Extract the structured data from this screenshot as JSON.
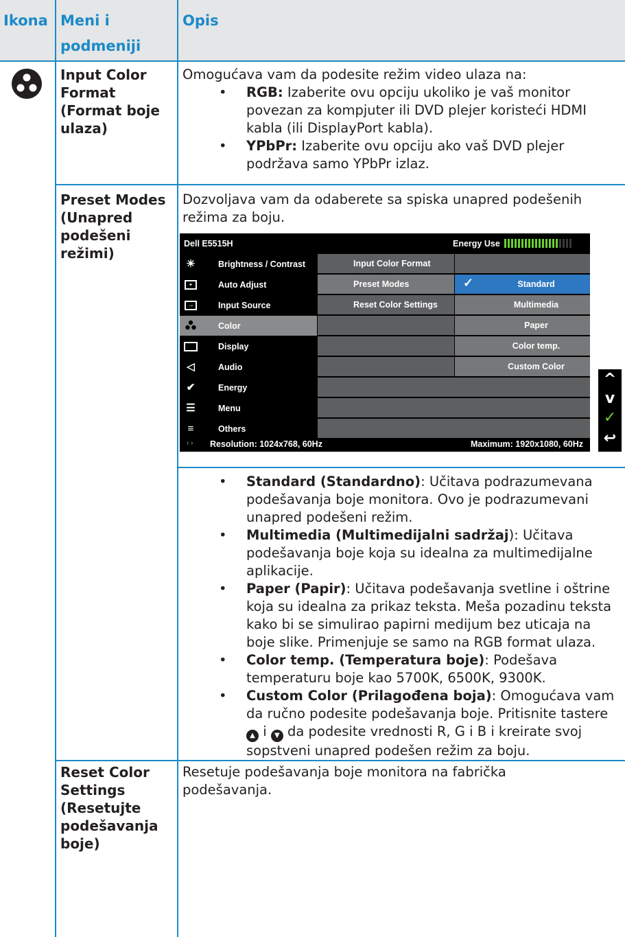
{
  "header": {
    "col_icon": "Ikona",
    "col_menu_line1": "Meni i",
    "col_menu_line2": "podmeniji",
    "col_desc": "Opis"
  },
  "row1": {
    "icon": "color-icon",
    "title_lines": [
      "Input Color",
      "Format",
      "(Format boje",
      "ulaza)"
    ],
    "intro": "Omogućava vam da podesite režim video ulaza na:",
    "items": [
      {
        "term": "RGB:",
        "text": " Izaberite ovu opciju ukoliko je vaš monitor povezan za kompjuter ili DVD plejer koristeći HDMI kabla (ili DisplayPort kabla)."
      },
      {
        "term": "YPbPr:",
        "text": " Izaberite ovu opciju ako vaš DVD plejer podržava samo YPbPr izlaz."
      }
    ]
  },
  "row2": {
    "title_lines": [
      "Preset Modes",
      "(Unapred",
      "podešeni",
      "režimi)"
    ],
    "intro": "Dozvoljava vam da odaberete sa spiska unapred podešenih režima za boju.",
    "items": [
      {
        "term": "Standard (Standardno)",
        "text": ": Učitava podrazumevana podešavanja boje monitora. Ovo je podrazumevani unapred podešeni režim."
      },
      {
        "term": "Multimedia (Multimedijalni sadržaj",
        "text": "): Učitava podešavanja boje koja su idealna za multimedijalne aplikacije."
      },
      {
        "term": "Paper (Papir)",
        "text": ": Učitava podešavanja svetline i oštrine koja su idealna za prikaz teksta. Meša pozadinu teksta kako bi se simulirao papirni medijum bez uticaja na boje slike. Primenjuje se samo na RGB format ulaza."
      },
      {
        "term": "Color temp. (Temperatura boje)",
        "text": ": Podešava temperaturu boje kao 5700K, 6500K, 9300K."
      },
      {
        "term": "Custom Color (Prilagođena boja)",
        "text": ": Omogućava vam da ručno podesite podešavanja boje. Pritisnite tastere",
        "mid": " i ",
        "text2": " da podesite vrednosti R, G i B i kreirate svoj sopstveni unapred podešen režim za boju."
      }
    ]
  },
  "row3": {
    "title_lines": [
      "Reset Color",
      "Settings",
      "(Resetujte",
      "podešavanja",
      "boje)"
    ],
    "desc": "Resetuje podešavanja boje monitora na fabrička podešavanja."
  },
  "osd": {
    "model": "Dell E5515H",
    "energy_label": "Energy Use",
    "energy_level": 0.8,
    "menu": [
      {
        "label": "Brightness / Contrast",
        "icon": "brightness-icon"
      },
      {
        "label": "Auto Adjust",
        "icon": "auto-adjust-icon"
      },
      {
        "label": "Input Source",
        "icon": "input-source-icon"
      },
      {
        "label": "Color",
        "icon": "color-icon",
        "selected": true
      },
      {
        "label": "Display",
        "icon": "display-icon"
      },
      {
        "label": "Audio",
        "icon": "audio-icon"
      },
      {
        "label": "Energy",
        "icon": "energy-icon"
      },
      {
        "label": "Menu",
        "icon": "menu-icon"
      },
      {
        "label": "Others",
        "icon": "others-icon"
      }
    ],
    "submenu": [
      "Input Color Format",
      "Preset Modes",
      "Reset Color Settings"
    ],
    "options": [
      "Standard",
      "Multimedia",
      "Paper",
      "Color temp.",
      "Custom Color"
    ],
    "selected_option": "Standard",
    "resolution": "Resolution: 1024x768, 60Hz",
    "maximum": "Maximum: 1920x1080, 60Hz",
    "nav_buttons": [
      "up-arrow-icon",
      "down-arrow-icon",
      "check-icon",
      "back-icon"
    ],
    "colors": {
      "selected_blue": "#2e78c2",
      "energy_green": "#6bd033",
      "accent": "#1b8ac8"
    }
  }
}
